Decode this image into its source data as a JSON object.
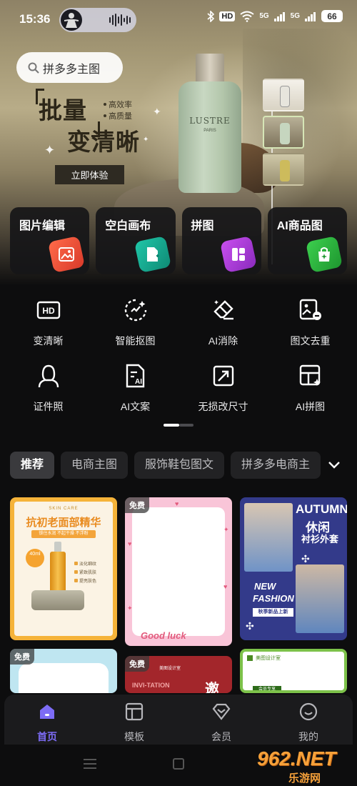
{
  "status_bar": {
    "time": "15:36",
    "hd_label": "HD",
    "signal_labels": [
      "5G",
      "5G"
    ],
    "battery": "66"
  },
  "search": {
    "placeholder": "拼多多主图"
  },
  "banner": {
    "title_line1": "批量",
    "title_line2": "变清晰",
    "tags": [
      "高效率",
      "高质量"
    ],
    "cta": "立即体验",
    "product_brand": "LUSTRE",
    "product_sub": "PARIS"
  },
  "feature_cards": [
    {
      "label": "图片编辑",
      "icon": "image-edit-icon",
      "color": "#e8513a"
    },
    {
      "label": "空白画布",
      "icon": "blank-canvas-icon",
      "color": "#16a88f"
    },
    {
      "label": "拼图",
      "icon": "collage-icon",
      "color": "#b23fd6"
    },
    {
      "label": "AI商品图",
      "icon": "ai-product-icon",
      "color": "#27a83a"
    }
  ],
  "tools": [
    {
      "label": "变清晰",
      "icon": "hd-icon"
    },
    {
      "label": "智能抠图",
      "icon": "smart-cutout-icon"
    },
    {
      "label": "AI消除",
      "icon": "ai-eraser-icon"
    },
    {
      "label": "图文去重",
      "icon": "dedupe-icon"
    },
    {
      "label": "证件照",
      "icon": "id-photo-icon"
    },
    {
      "label": "AI文案",
      "icon": "ai-copywriting-icon"
    },
    {
      "label": "无损改尺寸",
      "icon": "resize-icon"
    },
    {
      "label": "AI拼图",
      "icon": "ai-collage-icon"
    }
  ],
  "category_tabs": [
    "推荐",
    "电商主图",
    "服饰鞋包图文",
    "拼多多电商主"
  ],
  "active_category": "推荐",
  "templates": {
    "t1": {
      "sub": "SKIN CARE",
      "headline": "抗初老面部精华",
      "strip": "锁住水润 不起干燥 不浮粉",
      "badge": "40ml",
      "features": [
        "淡化细纹",
        "紧致肌肤",
        "提亮肤色"
      ]
    },
    "t2": {
      "free": "免费",
      "caption": "Good luck"
    },
    "t3": {
      "line1": "AUTUMN",
      "line2": "休闲",
      "line3": "衬衫外套",
      "line4": "NEW",
      "line5": "FASHION",
      "strip": "秋季新品上新"
    },
    "t4": {
      "free": "免费"
    },
    "t5": {
      "free": "免费",
      "text1": "INVI-TATION",
      "text2": "邀",
      "small": "美图设计室"
    },
    "t6": {
      "header": "美图设计室",
      "bar": "会员专享"
    }
  },
  "bottom_nav": [
    {
      "label": "首页",
      "icon": "home-icon",
      "active": true
    },
    {
      "label": "模板",
      "icon": "template-icon",
      "active": false
    },
    {
      "label": "会员",
      "icon": "vip-icon",
      "active": false
    },
    {
      "label": "我的",
      "icon": "profile-icon",
      "active": false
    }
  ],
  "watermark": {
    "text": "962.NET",
    "sub": "乐游网"
  },
  "colors": {
    "accent": "#7d6cf6",
    "background": "#0d0d0e"
  }
}
